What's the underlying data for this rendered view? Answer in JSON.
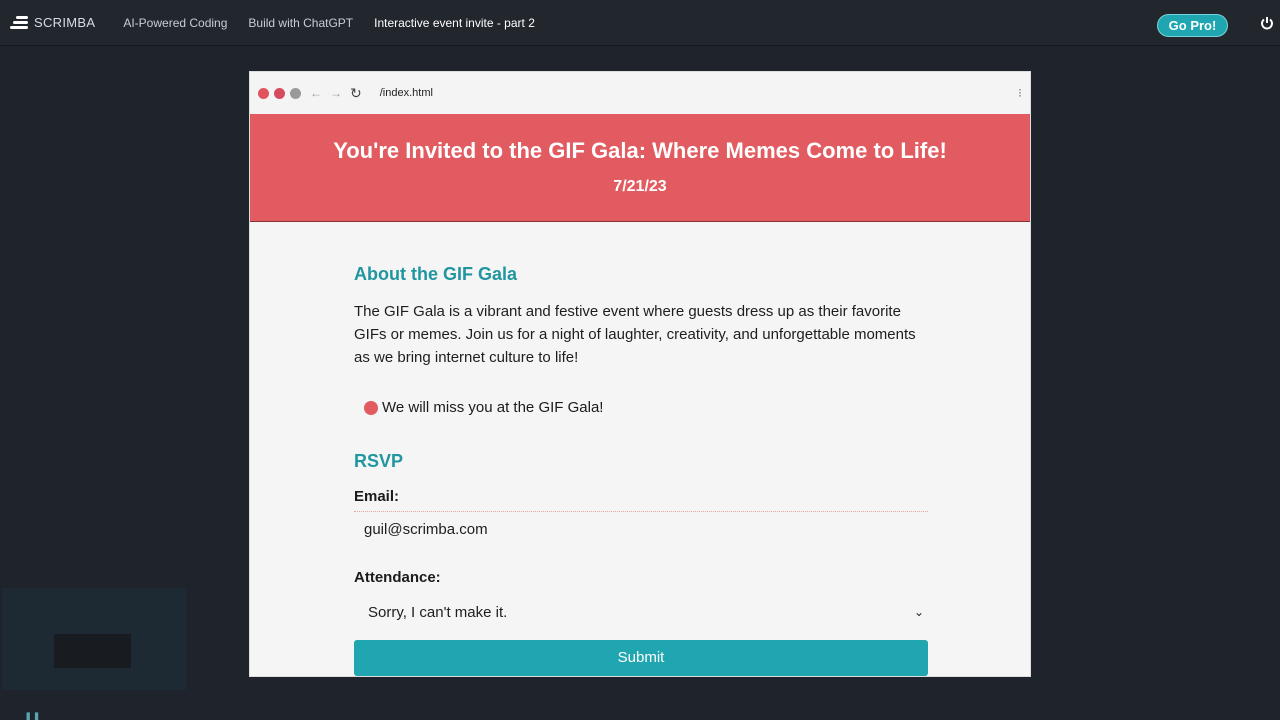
{
  "topbar": {
    "brand": "SCRIMBA",
    "crumbs": [
      "AI-Powered Coding",
      "Build with ChatGPT",
      "Interactive event invite - part 2"
    ],
    "go_pro": "Go Pro!"
  },
  "browser": {
    "url": "/index.html"
  },
  "page": {
    "title": "You're Invited to the GIF Gala: Where Memes Come to Life!",
    "date": "7/21/23",
    "about_heading": "About the GIF Gala",
    "about_text": "The GIF Gala is a vibrant and festive event where guests dress up as their favorite GIFs or memes. Join us for a night of laughter, creativity, and unforgettable moments as we bring internet culture to life!",
    "status_message": "We will miss you at the GIF Gala!",
    "rsvp_heading": "RSVP",
    "email_label": "Email:",
    "email_value": "guil@scrimba.com",
    "attendance_label": "Attendance:",
    "attendance_value": "Sorry, I can't make it.",
    "submit_label": "Submit"
  },
  "colors": {
    "hero": "#e15b60",
    "accent": "#20a6b0"
  }
}
